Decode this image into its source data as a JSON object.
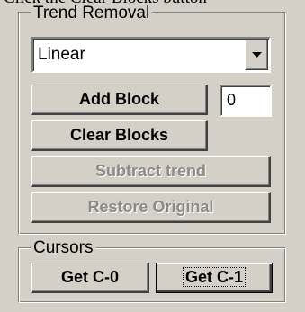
{
  "top_caption": "Click the Clear Blocks button",
  "trend_group": {
    "title": "Trend Removal",
    "method_select": {
      "value": "Linear"
    },
    "add_block_label": "Add Block",
    "block_count": "0",
    "clear_blocks_label": "Clear Blocks",
    "subtract_trend_label": "Subtract trend",
    "restore_original_label": "Restore Original"
  },
  "cursors_group": {
    "title": "Cursors",
    "get_c0_label": "Get C-0",
    "get_c1_label": "Get C-1"
  }
}
